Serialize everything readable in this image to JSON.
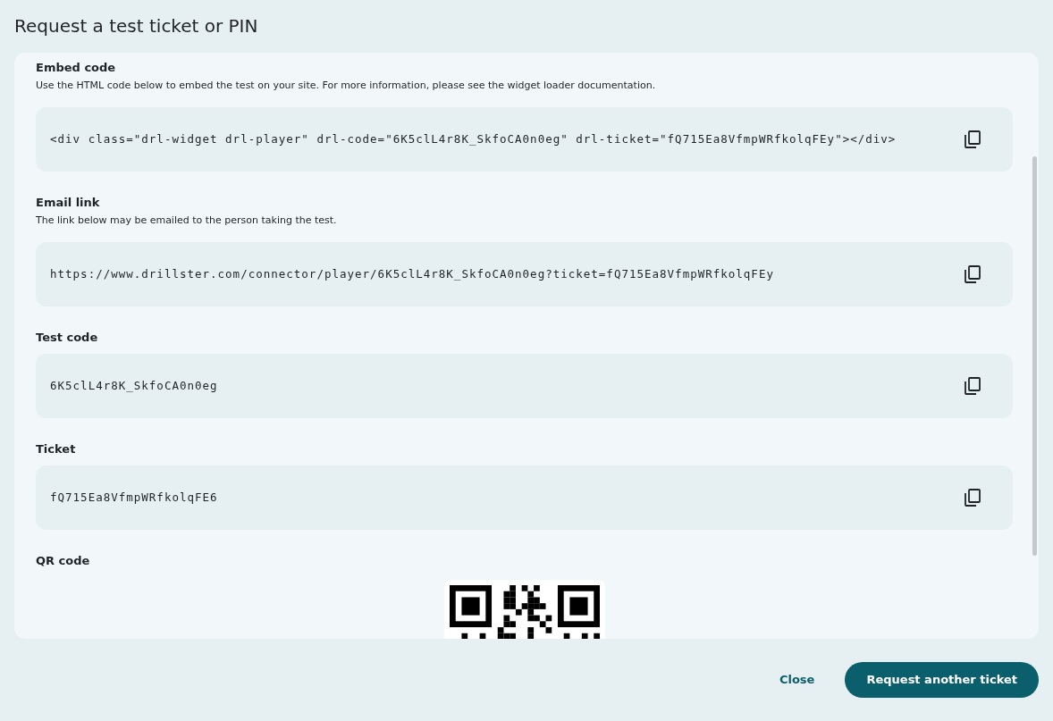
{
  "dialog": {
    "title": "Request a test ticket or PIN"
  },
  "sections": [
    {
      "kind": "field",
      "label": "Embed code",
      "description": "Use the HTML code below to embed the test on your site. For more information, please see the widget loader documentation.",
      "value": "<div class=\"drl-widget drl-player\" drl-code=\"6K5clL4r8K_SkfoCA0n0eg\" drl-ticket=\"fQ715Ea8VfmpWRfkolqFEy\"></div>"
    },
    {
      "kind": "field",
      "label": "Email link",
      "description": "The link below may be emailed to the person taking the test.",
      "value": "https://www.drillster.com/connector/player/6K5clL4r8K_SkfoCA0n0eg?ticket=fQ715Ea8VfmpWRfkolqFEy"
    },
    {
      "kind": "field",
      "label": "Test code",
      "value": "6K5clL4r8K_SkfoCA0n0eg"
    },
    {
      "kind": "field",
      "label": "Ticket",
      "value": "fQ715Ea8VfmpWRfkolqFE6"
    },
    {
      "kind": "qr",
      "label": "QR code"
    }
  ],
  "buttons": [
    {
      "kind": "text",
      "label": "Close"
    },
    {
      "kind": "primary",
      "label": "Request another ticket"
    }
  ]
}
